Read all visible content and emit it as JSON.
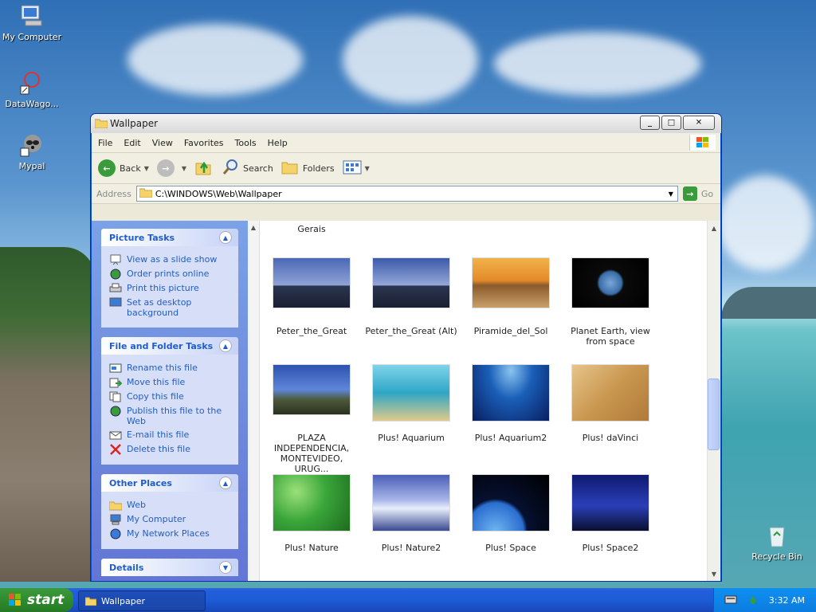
{
  "desktop": {
    "icons": [
      {
        "label": "My Computer"
      },
      {
        "label": "DataWago..."
      },
      {
        "label": "Mypal"
      },
      {
        "label": "Recycle Bin"
      }
    ]
  },
  "window": {
    "title": "Wallpaper",
    "menu": [
      "File",
      "Edit",
      "View",
      "Favorites",
      "Tools",
      "Help"
    ],
    "toolbar": {
      "back": "Back",
      "search": "Search",
      "folders": "Folders"
    },
    "address": {
      "label": "Address",
      "value": "C:\\WINDOWS\\Web\\Wallpaper",
      "go": "Go"
    }
  },
  "tasks": {
    "picture": {
      "title": "Picture Tasks",
      "items": [
        "View as a slide show",
        "Order prints online",
        "Print this picture",
        "Set as desktop background"
      ]
    },
    "file": {
      "title": "File and Folder Tasks",
      "items": [
        "Rename this file",
        "Move this file",
        "Copy this file",
        "Publish this file to the Web",
        "E-mail this file",
        "Delete this file"
      ]
    },
    "places": {
      "title": "Other Places",
      "items": [
        "Web",
        "My Computer",
        "My Network Places"
      ]
    },
    "details": {
      "title": "Details"
    }
  },
  "files": {
    "top_caption": "Gerais",
    "rows": [
      [
        "Peter_the_Great",
        "Peter_the_Great (Alt)",
        "Piramide_del_Sol",
        "Planet Earth, view from space"
      ],
      [
        "PLAZA INDEPENDENCIA, MONTEVIDEO, URUG...",
        "Plus! Aquarium",
        "Plus! Aquarium2",
        "Plus! daVinci"
      ],
      [
        "Plus! Nature",
        "Plus! Nature2",
        "Plus! Space",
        "Plus! Space2"
      ]
    ]
  },
  "taskbar": {
    "start": "start",
    "active_window": "Wallpaper",
    "clock": "3:32 AM"
  },
  "colors": {
    "xp_blue": "#0a4fd1",
    "task_pane_blue": "#6375d6",
    "start_green": "#2e8b2e"
  }
}
